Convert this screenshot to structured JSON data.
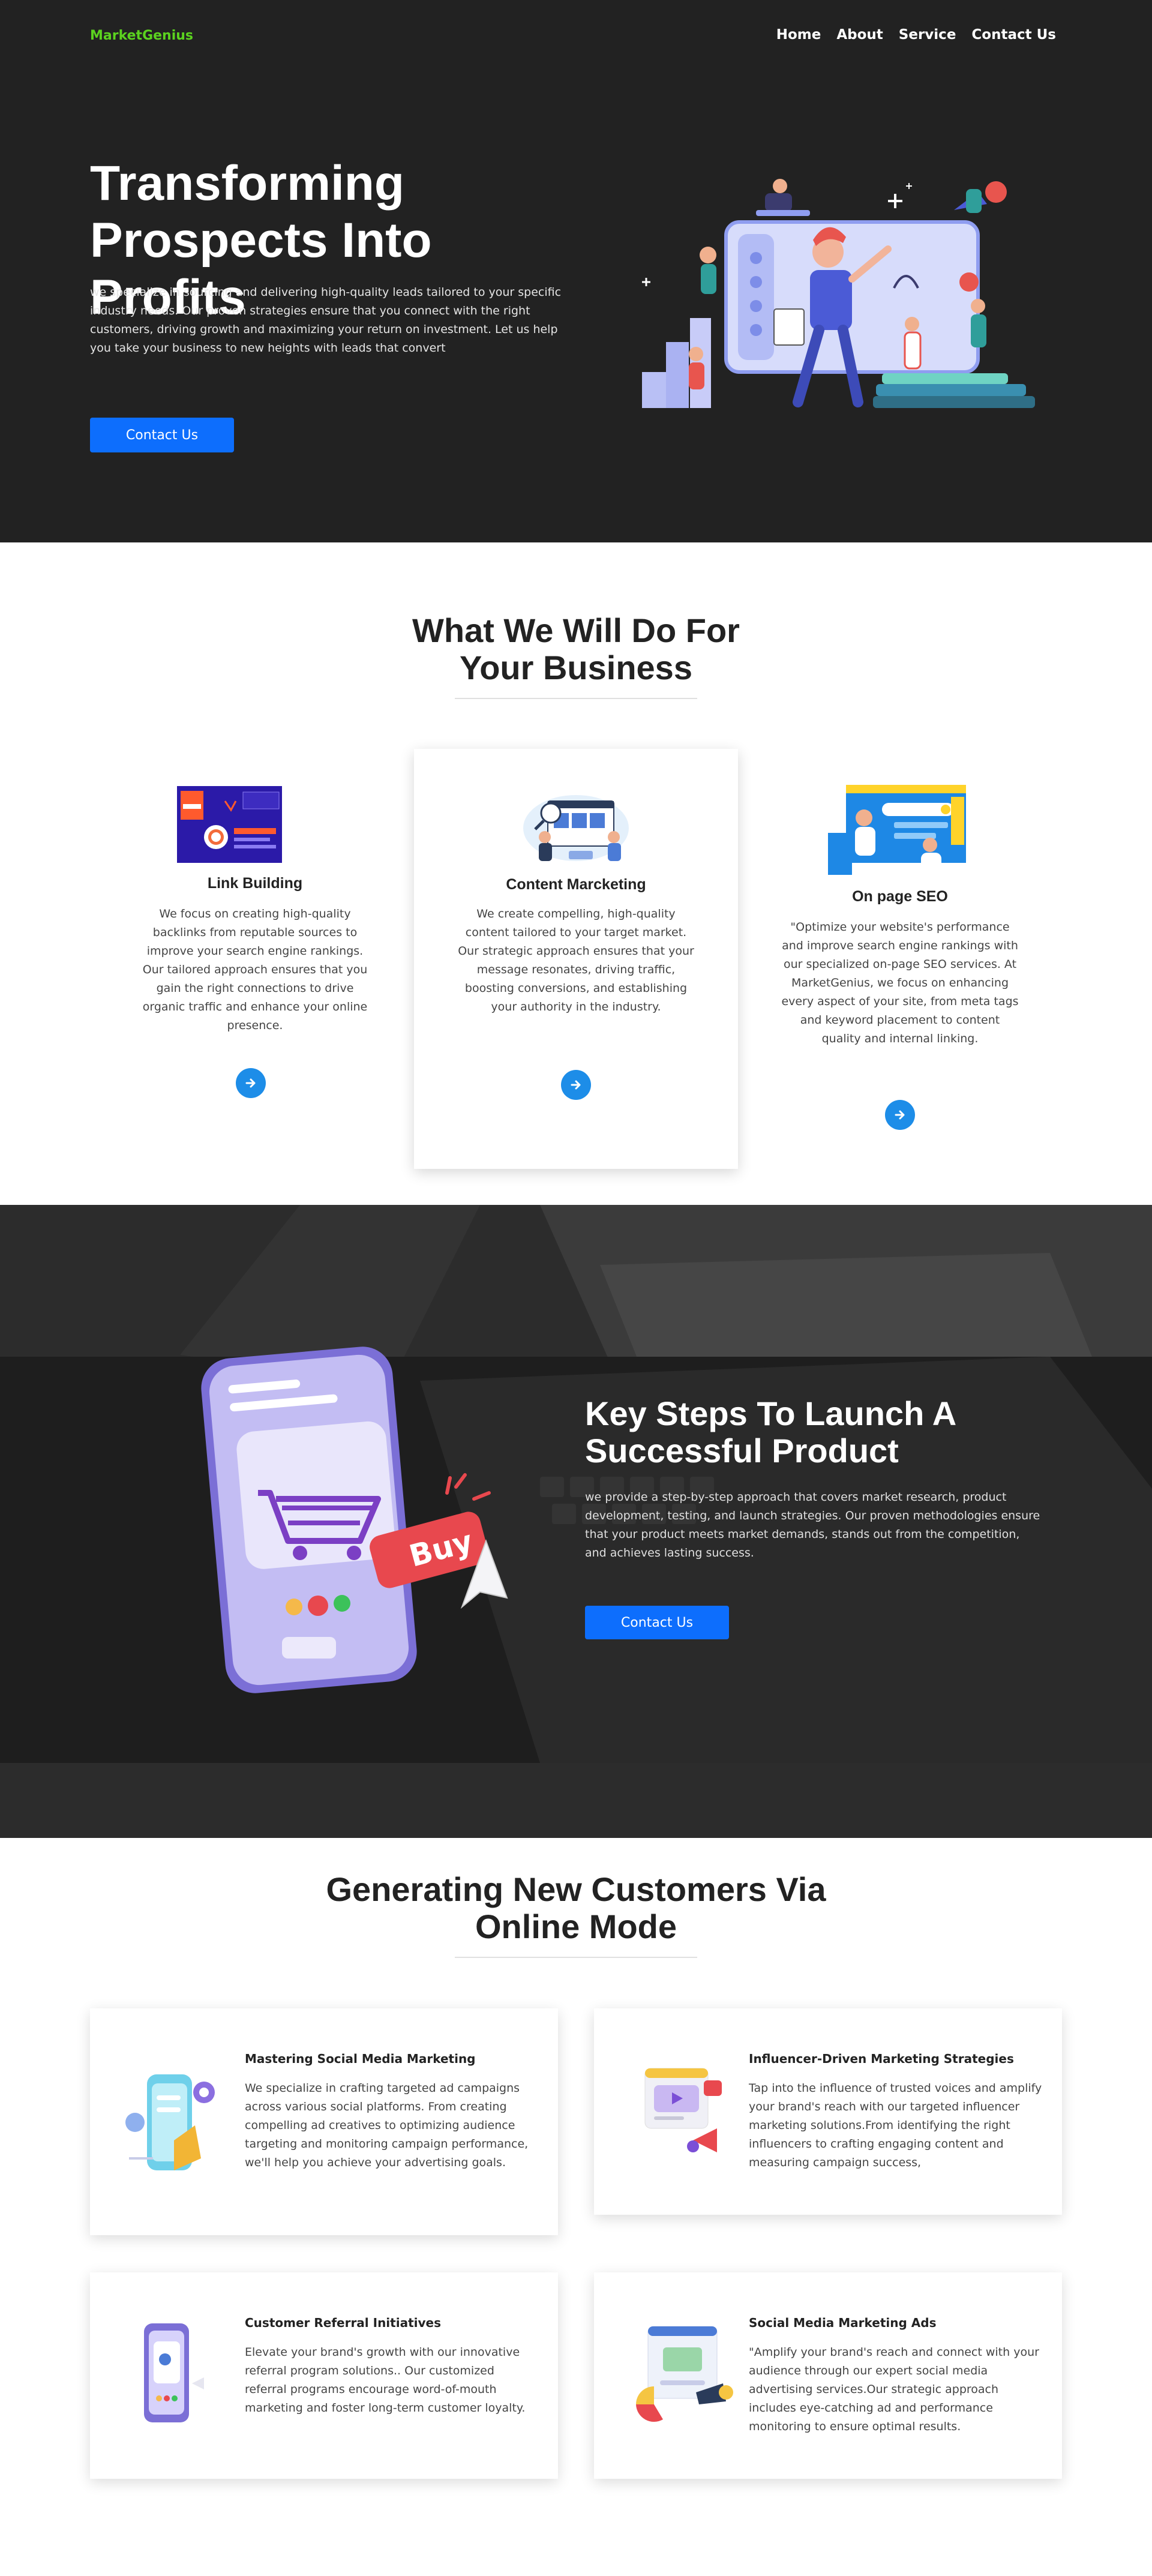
{
  "nav": {
    "brand": "MarketGenius",
    "links": [
      "Home",
      "About",
      "Service",
      "Contact Us"
    ]
  },
  "hero": {
    "title": "Transforming Prospects Into Profits",
    "text": "we specialize in sourcing and delivering high-quality leads tailored to your specific industry needs. Our proven strategies ensure that you connect with the right customers, driving growth and maximizing your return on investment. Let us help you take your business to new heights with leads that convert",
    "button": "Contact Us"
  },
  "services": {
    "title": "What We Will Do For Your Business",
    "cards": [
      {
        "title": "Link Building",
        "text": "We focus on creating high-quality backlinks from reputable sources to improve your search engine rankings. Our tailored approach ensures that you gain the right connections to drive organic traffic and enhance your online presence."
      },
      {
        "title": "Content Marcketing",
        "text": "We create compelling, high-quality content tailored to your target market. Our strategic approach ensures that your message resonates, driving traffic, boosting conversions, and establishing your authority in the industry."
      },
      {
        "title": "On page SEO",
        "text": "\"Optimize your website's performance and improve search engine rankings with our specialized on-page SEO services. At MarketGenius, we focus on enhancing every aspect of your site, from meta tags and keyword placement to content quality and internal linking."
      }
    ]
  },
  "steps": {
    "title": "Key Steps To Launch A Successful Product",
    "text": "we provide a step-by-step approach that covers market research, product development, testing, and launch strategies. Our proven methodologies ensure that your product meets market demands, stands out from the competition, and achieves lasting success.",
    "button": "Contact Us",
    "buy_label": "Buy"
  },
  "customers": {
    "title": "Generating New Customers Via Online Mode",
    "cards": [
      {
        "title": "Mastering Social Media Marketing",
        "text": "We specialize in crafting targeted ad campaigns across various social platforms. From creating compelling ad creatives to optimizing audience targeting and monitoring campaign performance, we'll help you achieve your advertising goals."
      },
      {
        "title": "Influencer-Driven Marketing Strategies",
        "text": "Tap into the influence of trusted voices and amplify your brand's reach with our targeted influencer marketing solutions.From identifying the right influencers to crafting engaging content and measuring campaign success,"
      },
      {
        "title": "Customer Referral Initiatives",
        "text": "Elevate your brand's growth with our innovative referral program solutions.. Our customized referral programs encourage word-of-mouth marketing and foster long-term customer loyalty."
      },
      {
        "title": "Social Media Marketing Ads",
        "text": "\"Amplify your brand's reach and connect with your audience through our expert social media advertising services.Our strategic approach includes eye-catching ad and performance monitoring to ensure optimal results."
      }
    ]
  },
  "colors": {
    "brand": "#5bd21f",
    "accent": "#0d6efd",
    "arrow": "#1d8de8",
    "hero_bg": "#222222"
  }
}
